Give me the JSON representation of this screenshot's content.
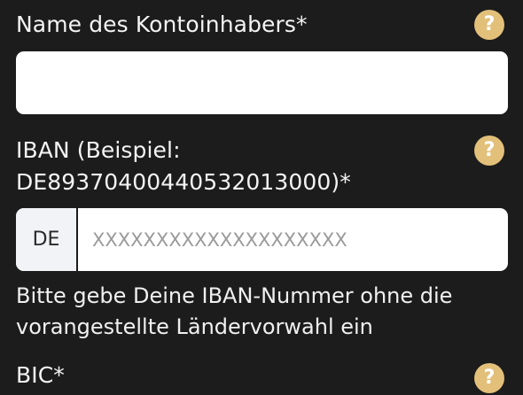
{
  "form": {
    "account_holder": {
      "label": "Name des Kontoinhabers*",
      "value": "",
      "help_glyph": "?"
    },
    "iban": {
      "label_line1": "IBAN (Beispiel:",
      "label_line2": "DE89370400440532013000)*",
      "country_prefix": "DE",
      "placeholder": "XXXXXXXXXXXXXXXXXXXX",
      "help_glyph": "?",
      "hint_line1": "Bitte gebe Deine IBAN-Nummer ohne die",
      "hint_line2": "vorangestellte Ländervorwahl ein"
    },
    "bic": {
      "label": "BIC*",
      "help_glyph": "?"
    }
  },
  "colors": {
    "background": "#1c1c1c",
    "help_icon": "#e3c07a",
    "input_bg": "#ffffff",
    "prefix_bg": "#f1f3f7"
  }
}
